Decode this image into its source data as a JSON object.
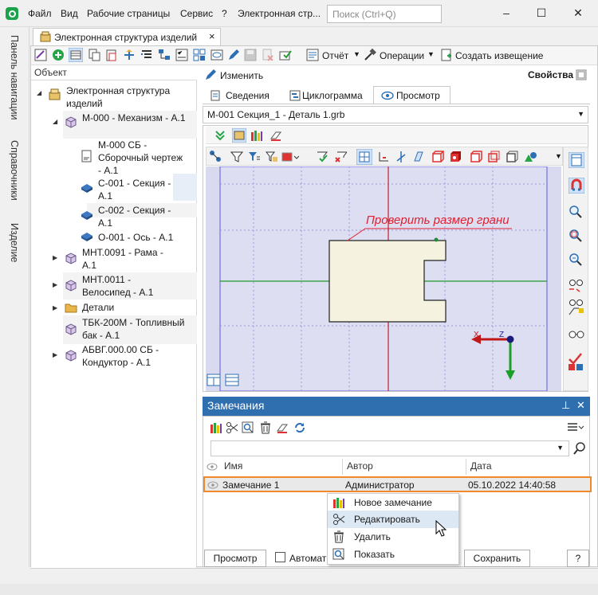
{
  "menu": [
    "Файл",
    "Вид",
    "Рабочие страницы",
    "Сервис",
    "?",
    "Электронная стр..."
  ],
  "search": {
    "placeholder": "Поиск (Ctrl+Q)"
  },
  "window_controls": {
    "minimize": "–",
    "maximize": "☐",
    "close": "✕"
  },
  "left_nav": [
    "Панель навигации",
    "Справочники",
    "Изделие"
  ],
  "doc_tab": {
    "label": "Электронная структура изделий",
    "close": "×"
  },
  "toolbar": {
    "report": "Отчёт",
    "operations": "Операции",
    "notice": "Создать извещение",
    "edit": "Изменить",
    "properties": "Свойства"
  },
  "tree": {
    "header": "Объект",
    "nodes": [
      "Электронная структура изделий",
      "М-000 - Механизм - А.1",
      "М-000 СБ - Сборочный чертеж - А.1",
      "С-001 - Секция - А.1",
      "С-002 - Секция - А.1",
      "О-001 - Ось - А.1",
      "МНТ.0091 - Рама - А.1",
      "МНТ.0011 - Велосипед - А.1",
      "Детали",
      "ТБК-200М - Топливный бак - А.1",
      "АБВГ.000.00 СБ - Кондуктор - А.1"
    ]
  },
  "tabs": [
    "Сведения",
    "Циклограмма",
    "Просмотр"
  ],
  "viewer": {
    "file": "М-001 Секция_1 - Деталь 1.grb",
    "annotation": "Проверить размер грани",
    "axis_x": "X",
    "axis_z": "Z"
  },
  "remarks": {
    "title": "Замечания",
    "columns": [
      "Имя",
      "Автор",
      "Дата"
    ],
    "row": {
      "name": "Замечание 1",
      "author": "Администратор",
      "date": "05.10.2022 14:40:58"
    },
    "context_menu": [
      "Новое замечание",
      "Редактировать",
      "Удалить",
      "Показать"
    ],
    "buttons": {
      "view": "Просмотр",
      "auto": "Автомат",
      "save": "Сохранить",
      "help": "?"
    }
  },
  "colors": {
    "accent": "#2f6fb0",
    "selection_border": "#f0892b",
    "app_icon": "#1aa34a"
  }
}
